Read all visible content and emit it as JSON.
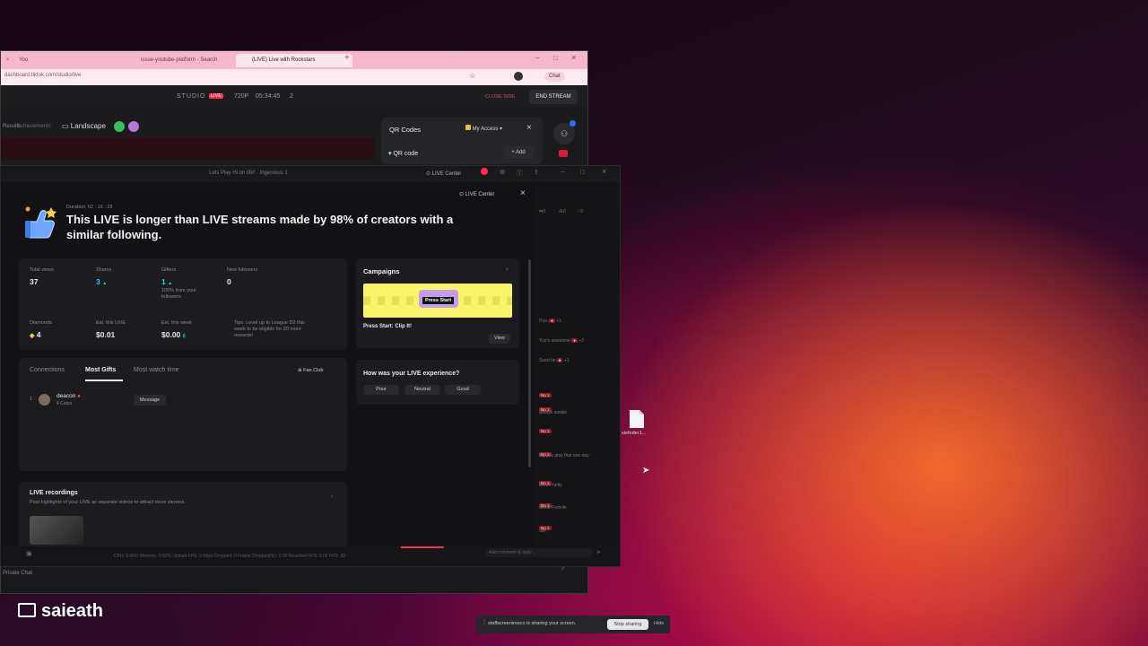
{
  "browser": {
    "tabs": [
      {
        "label": "Yoo"
      },
      {
        "label": "issue-youtube-platform - Search"
      },
      {
        "label": "(LIVE) Live with Rockstars"
      }
    ],
    "address": "dashboard.tiktok.com/studio/live",
    "chat_label": "Chat"
  },
  "studio": {
    "logo": "STUDIO",
    "live_badge": "LIVE",
    "quality": "720P",
    "timer": "05:34:45",
    "viewers_icon_count": "2",
    "close_live": "CLOSE SIDE",
    "end_stream": "END STREAM",
    "tab_results": "Results",
    "tab_achievements": "Achievements",
    "orientation": "Landscape",
    "qr_codes_title": "QR Codes",
    "my_access": "My Access",
    "qr_code_label": "QR code",
    "add_label": "+ Add"
  },
  "panel": {
    "window_title": "Lets Play Hi on life! · Ingenious 1",
    "live_center_top": "LIVE Center",
    "live_center_btn": "LIVE Center",
    "duration": "Duration: 02 : 16 : 29",
    "headline": "This LIVE is longer than LIVE streams made by 98% of creators with a similar following.",
    "stats": [
      {
        "label": "Total views",
        "value": "37"
      },
      {
        "label": "Shares",
        "value": "3",
        "trend": "▲"
      },
      {
        "label": "Gifters",
        "value": "1",
        "trend": "▲",
        "sub": "100% from your followers"
      },
      {
        "label": "New followers",
        "value": "0"
      }
    ],
    "stats2": [
      {
        "label": "Diamonds",
        "value": "4"
      },
      {
        "label": "Est. this LIVE",
        "value": "$0.01"
      },
      {
        "label": "Est. this week",
        "value": "$0.00"
      }
    ],
    "tip": "Tips: Level up to League D2 this week to be eligible for 20 more rewards!",
    "tabs": [
      "Connections",
      "Most Gifts",
      "Most watch time"
    ],
    "fan_club": "Fan Club",
    "gifter": {
      "rank": "1",
      "name": "deacon",
      "sub": "4 Coins",
      "message_btn": "Message"
    },
    "recordings_title": "LIVE recordings",
    "recordings_sub": "Post highlights of your LIVE as separate videos to attract more viewers.",
    "campaigns_title": "Campaigns",
    "campaign_banner": "Press Start",
    "campaign_name": "Press Start: Clip It!",
    "view_btn": "View",
    "experience_q": "How was your LIVE experience?",
    "exp_opts": [
      "Poor",
      "Neutral",
      "Good"
    ],
    "side_counts": [
      "0",
      "0",
      "0"
    ],
    "chat_lines": [
      {
        "name": "Pixe",
        "text": "+1"
      },
      {
        "name": "Yuo's awesome",
        "text": "+2"
      },
      {
        "name": "Sued tie",
        "text": "+1"
      },
      {
        "name": "",
        "text": "No 1"
      },
      {
        "name": "",
        "text": "No 1"
      },
      {
        "name": "",
        "text": "always awake"
      },
      {
        "name": "",
        "text": "No 1"
      },
      {
        "name": "",
        "text": "No 1"
      },
      {
        "name": "",
        "text": "big you play that one day"
      },
      {
        "name": "",
        "text": "No 1"
      },
      {
        "name": "",
        "text": "brown hefty"
      },
      {
        "name": "",
        "text": "No 1"
      },
      {
        "name": "",
        "text": "about Fortnite"
      },
      {
        "name": "",
        "text": "No 1"
      },
      {
        "name": "",
        "text": "use"
      }
    ],
    "bottom_stats": "CPU: 0.00%   Memory: 0.00%   Upload FPS: 0 Kbps   Dropped: 0   Frame Dropped(%): 0.00   Reached FPS: 0.00   FPS: 30",
    "comment_placeholder": "Add comment & reply ...",
    "private_chat": "Private Chat"
  },
  "desktop": {
    "file_label": "siefeder1...",
    "user_name": "saieath"
  },
  "share_bar": {
    "text": "staffscreeniresco is sharing your screen.",
    "stop_btn": "Stop sharing",
    "hide_btn": "Hide"
  },
  "colors": {
    "accent_pink": "#fe2c55",
    "teal": "#20d5ec",
    "campaign_yellow": "#f8f36a"
  }
}
